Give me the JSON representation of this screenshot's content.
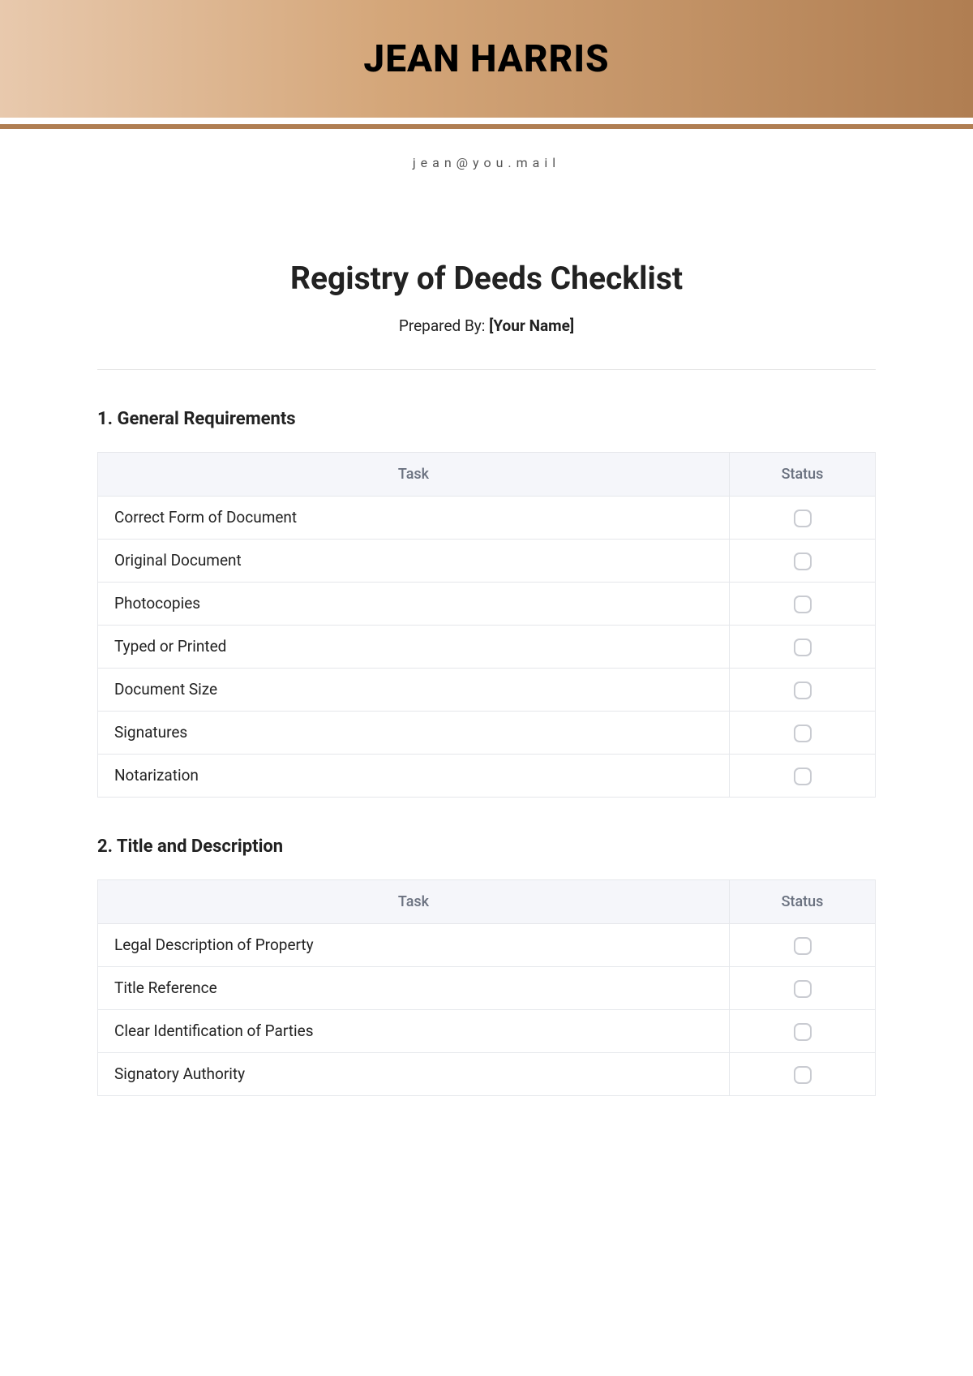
{
  "header": {
    "name": "JEAN HARRIS",
    "email": "jean@you.mail"
  },
  "document": {
    "title": "Registry of Deeds Checklist",
    "prepared_by_label": "Prepared By: ",
    "prepared_by_value": "[Your Name]"
  },
  "columns": {
    "task": "Task",
    "status": "Status"
  },
  "sections": [
    {
      "title": "1. General Requirements",
      "tasks": [
        "Correct Form of Document",
        "Original Document",
        "Photocopies",
        "Typed or Printed",
        "Document Size",
        "Signatures",
        "Notarization"
      ]
    },
    {
      "title": "2. Title and Description",
      "tasks": [
        "Legal Description of Property",
        "Title Reference",
        "Clear Identification of Parties",
        "Signatory Authority"
      ]
    }
  ]
}
